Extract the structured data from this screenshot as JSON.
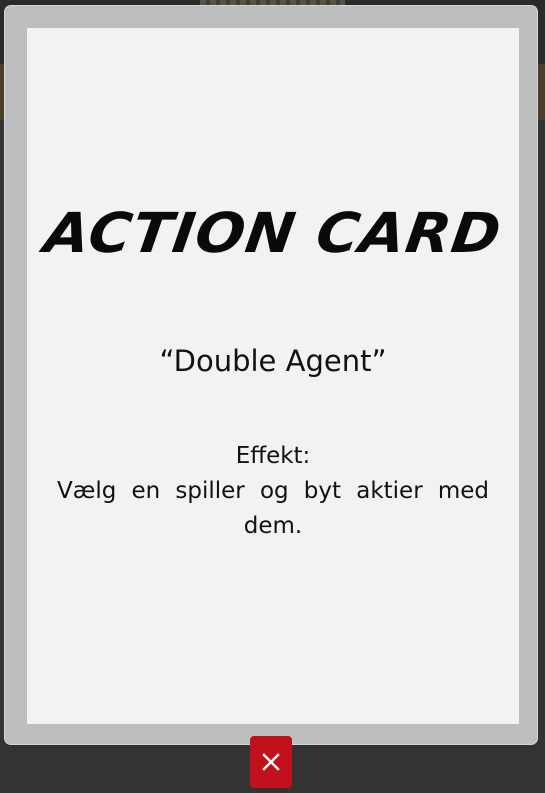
{
  "modal": {
    "card": {
      "type_heading": "ACTION CARD",
      "name": "“Double Agent”",
      "effect_label": "Effekt:",
      "effect_text": "Vælg en spiller og byt aktier med dem."
    },
    "close_icon": "close-icon"
  },
  "colors": {
    "backdrop": "#333333",
    "card_border": "#bdbebf",
    "card_face": "#f2f2f2",
    "close_button": "#c0111d",
    "text": "#111111"
  }
}
